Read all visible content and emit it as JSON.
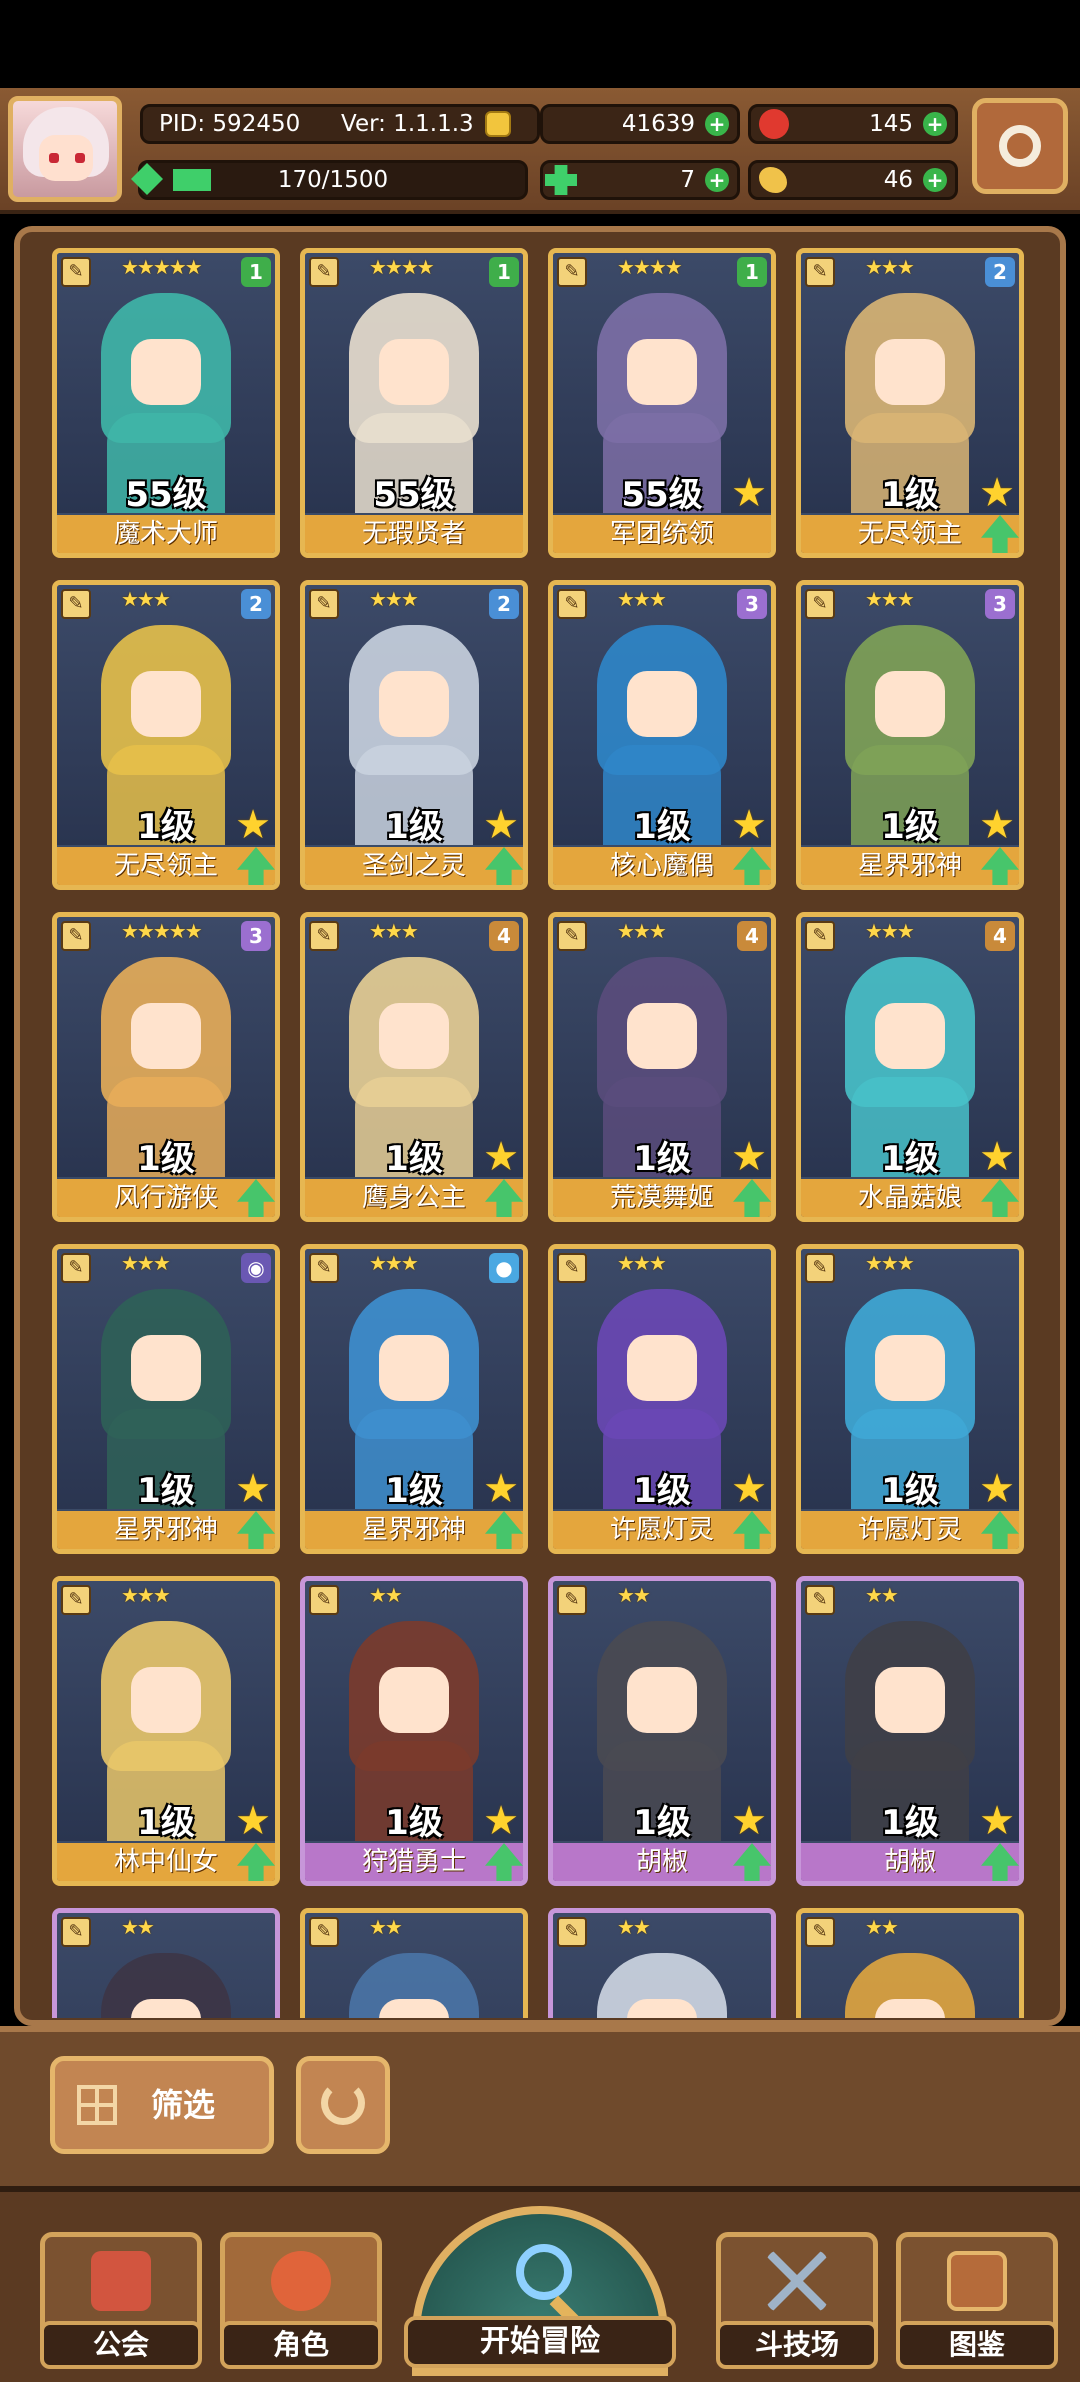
{
  "header": {
    "pid": "PID: 592450",
    "version": "Ver: 1.1.1.3",
    "gold": "41639",
    "gems": "145",
    "exp": "170/1500",
    "exp_progress": 0.113,
    "shards": "7",
    "food": "46"
  },
  "cards": [
    {
      "level": "55级",
      "name": "魔术大师",
      "stars": "★★★★★",
      "badge": "1",
      "badge_color": "#3fae4a",
      "frame": "gold",
      "art": "#3fb6a8",
      "star_up": false,
      "arrow": false
    },
    {
      "level": "55级",
      "name": "无瑕贤者",
      "stars": "★★★★",
      "badge": "1",
      "badge_color": "#3fae4a",
      "frame": "gold",
      "art": "#e9dfcf",
      "star_up": false,
      "arrow": false
    },
    {
      "level": "55级",
      "name": "军团统领",
      "stars": "★★★★",
      "badge": "1",
      "badge_color": "#3fae4a",
      "frame": "gold",
      "art": "#7c6fa6",
      "star_up": true,
      "arrow": false
    },
    {
      "level": "1级",
      "name": "无尽领主",
      "stars": "★★★",
      "badge": "2",
      "badge_color": "#4a8fd6",
      "frame": "gold",
      "art": "#d9b574",
      "star_up": true,
      "arrow": true
    },
    {
      "level": "1级",
      "name": "无尽领主",
      "stars": "★★★",
      "badge": "2",
      "badge_color": "#4a8fd6",
      "frame": "gold",
      "art": "#e6c04a",
      "star_up": true,
      "arrow": true
    },
    {
      "level": "1级",
      "name": "圣剑之灵",
      "stars": "★★★",
      "badge": "2",
      "badge_color": "#4a8fd6",
      "frame": "gold",
      "art": "#c9d2df",
      "star_up": true,
      "arrow": true
    },
    {
      "level": "1级",
      "name": "核心魔偶",
      "stars": "★★★",
      "badge": "3",
      "badge_color": "#9b6fd0",
      "frame": "gold",
      "art": "#2f86c9",
      "star_up": true,
      "arrow": true
    },
    {
      "level": "1级",
      "name": "星界邪神",
      "stars": "★★★",
      "badge": "3",
      "badge_color": "#9b6fd0",
      "frame": "gold",
      "art": "#7fa257",
      "star_up": true,
      "arrow": true
    },
    {
      "level": "1级",
      "name": "风行游侠",
      "stars": "★★★★★",
      "badge": "3",
      "badge_color": "#9b6fd0",
      "frame": "gold",
      "art": "#e7ad59",
      "star_up": false,
      "arrow": true
    },
    {
      "level": "1级",
      "name": "鹰身公主",
      "stars": "★★★",
      "badge": "4",
      "badge_color": "#c98a3a",
      "frame": "gold",
      "art": "#e8cf95",
      "star_up": true,
      "arrow": true
    },
    {
      "level": "1级",
      "name": "荒漠舞姬",
      "stars": "★★★",
      "badge": "4",
      "badge_color": "#c98a3a",
      "frame": "gold",
      "art": "#5a4c7c",
      "star_up": true,
      "arrow": true
    },
    {
      "level": "1级",
      "name": "水晶菇娘",
      "stars": "★★★",
      "badge": "4",
      "badge_color": "#c98a3a",
      "frame": "gold",
      "art": "#48c1c9",
      "star_up": true,
      "arrow": true
    },
    {
      "level": "1级",
      "name": "星界邪神",
      "stars": "★★★",
      "badge": "◉",
      "badge_color": "#6a58b3",
      "frame": "gold",
      "art": "#2f6158",
      "star_up": true,
      "arrow": true
    },
    {
      "level": "1级",
      "name": "星界邪神",
      "stars": "★★★",
      "badge": "●",
      "badge_color": "#4aa8e2",
      "frame": "gold",
      "art": "#3e8fcf",
      "star_up": true,
      "arrow": true
    },
    {
      "level": "1级",
      "name": "许愿灯灵",
      "stars": "★★★",
      "badge": "",
      "badge_color": "",
      "frame": "gold",
      "art": "#6a48b5",
      "star_up": true,
      "arrow": true
    },
    {
      "level": "1级",
      "name": "许愿灯灵",
      "stars": "★★★",
      "badge": "",
      "badge_color": "",
      "frame": "gold",
      "art": "#3fa8d6",
      "star_up": true,
      "arrow": true
    },
    {
      "level": "1级",
      "name": "林中仙女",
      "stars": "★★★",
      "badge": "",
      "badge_color": "",
      "frame": "gold",
      "art": "#e9c76a",
      "star_up": true,
      "arrow": true
    },
    {
      "level": "1级",
      "name": "狩猎勇士",
      "stars": "★★",
      "badge": "",
      "badge_color": "",
      "frame": "purple",
      "art": "#7b3b2c",
      "star_up": true,
      "arrow": true
    },
    {
      "level": "1级",
      "name": "胡椒",
      "stars": "★★",
      "badge": "",
      "badge_color": "",
      "frame": "purple",
      "art": "#4a4a52",
      "star_up": true,
      "arrow": true
    },
    {
      "level": "1级",
      "name": "胡椒",
      "stars": "★★",
      "badge": "",
      "badge_color": "",
      "frame": "purple",
      "art": "#3f3f47",
      "star_up": true,
      "arrow": true
    },
    {
      "level": "",
      "name": "",
      "stars": "★★",
      "badge": "",
      "badge_color": "",
      "frame": "purple",
      "art": "#3d3546",
      "star_up": false,
      "arrow": false
    },
    {
      "level": "",
      "name": "",
      "stars": "★★",
      "badge": "",
      "badge_color": "",
      "frame": "gold",
      "art": "#4a74a6",
      "star_up": false,
      "arrow": false
    },
    {
      "level": "",
      "name": "",
      "stars": "★★",
      "badge": "",
      "badge_color": "",
      "frame": "purple",
      "art": "#cfd7e3",
      "star_up": false,
      "arrow": false
    },
    {
      "level": "",
      "name": "",
      "stars": "★★",
      "badge": "",
      "badge_color": "",
      "frame": "gold",
      "art": "#e0a53f",
      "star_up": false,
      "arrow": false
    }
  ],
  "controls": {
    "filter_label": "筛选"
  },
  "nav": {
    "guild": "公会",
    "characters": "角色",
    "adventure": "开始冒险",
    "arena": "斗技场",
    "codex": "图鉴"
  }
}
